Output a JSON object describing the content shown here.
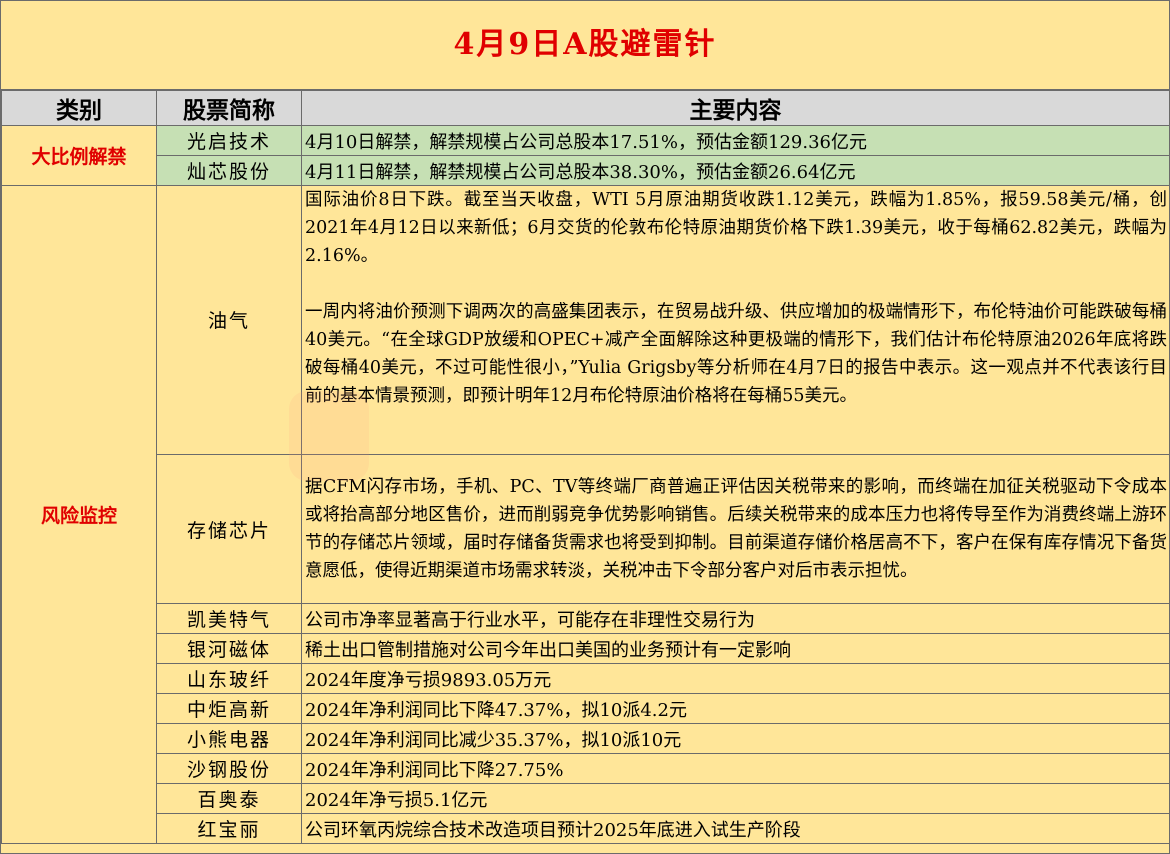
{
  "title": "4月9日A股避雷针",
  "headers": {
    "category": "类别",
    "stock": "股票简称",
    "content": "主要内容"
  },
  "sections": [
    {
      "category": "大比例解禁",
      "rows": [
        {
          "name": "光启技术",
          "content": "4月10日解禁，解禁规模占公司总股本17.51%，预估金额129.36亿元"
        },
        {
          "name": "灿芯股份",
          "content": "4月11日解禁，解禁规模占公司总股本38.30%，预估金额26.64亿元"
        }
      ]
    },
    {
      "category": "风险监控",
      "rows": [
        {
          "name": "油气",
          "para1": "国际油价8日下跌。截至当天收盘，WTI 5月原油期货收跌1.12美元，跌幅为1.85%，报59.58美元/桶，创2021年4月12日以来新低；6月交货的伦敦布伦特原油期货价格下跌1.39美元，收于每桶62.82美元，跌幅为2.16%。",
          "para2": "一周内将油价预测下调两次的高盛集团表示，在贸易战升级、供应增加的极端情形下，布伦特油价可能跌破每桶40美元。“在全球GDP放缓和OPEC+减产全面解除这种更极端的情形下，我们估计布伦特原油2026年底将跌破每桶40美元，不过可能性很小，”Yulia Grigsby等分析师在4月7日的报告中表示。这一观点并不代表该行目前的基本情景预测，即预计明年12月布伦特原油价格将在每桶55美元。"
        },
        {
          "name": "存储芯片",
          "content": "据CFM闪存市场，手机、PC、TV等终端厂商普遍正评估因关税带来的影响，而终端在加征关税驱动下令成本或将抬高部分地区售价，进而削弱竞争优势影响销售。后续关税带来的成本压力也将传导至作为消费终端上游环节的存储芯片领域，届时存储备货需求也将受到抑制。目前渠道存储价格居高不下，客户在保有库存情况下备货意愿低，使得近期渠道市场需求转淡，关税冲击下令部分客户对后市表示担忧。"
        },
        {
          "name": "凯美特气",
          "content": "公司市净率显著高于行业水平，可能存在非理性交易行为"
        },
        {
          "name": "银河磁体",
          "content": "稀土出口管制措施对公司今年出口美国的业务预计有一定影响"
        },
        {
          "name": "山东玻纤",
          "content": "2024年度净亏损9893.05万元"
        },
        {
          "name": "中炬高新",
          "content": "2024年净利润同比下降47.37%，拟10派4.2元"
        },
        {
          "name": "小熊电器",
          "content": "2024年净利润同比减少35.37%，拟10派10元"
        },
        {
          "name": "沙钢股份",
          "content": "2024年净利润同比下降27.75%"
        },
        {
          "name": "百奥泰",
          "content": "2024年净亏损5.1亿元"
        },
        {
          "name": "红宝丽",
          "content": "公司环氧丙烷综合技术改造项目预计2025年底进入试生产阶段"
        }
      ]
    }
  ]
}
